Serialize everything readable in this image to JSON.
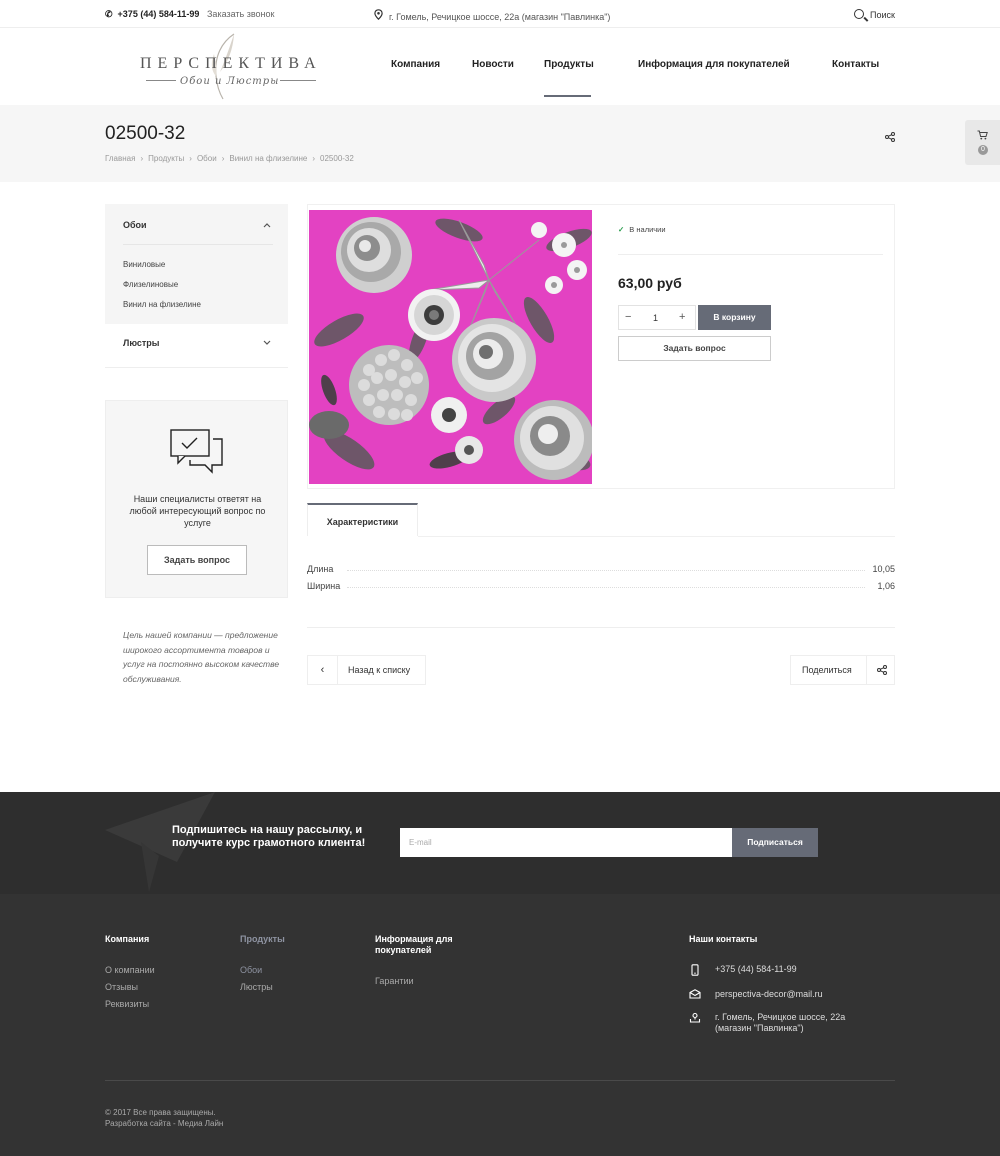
{
  "topbar": {
    "phone": "+375 (44) 584-11-99",
    "callback": "Заказать звонок",
    "address": "г. Гомель, Речицкое шоссе, 22а (магазин \"Павлинка\")",
    "search": "Поиск"
  },
  "logo": {
    "main": "ПЕРСПЕКТИВА",
    "sub": "Обои и Люстры"
  },
  "nav": [
    {
      "label": "Компания"
    },
    {
      "label": "Новости"
    },
    {
      "label": "Продукты",
      "active": true
    },
    {
      "label": "Информация для покупателей"
    },
    {
      "label": "Контакты"
    }
  ],
  "page": {
    "title": "02500-32",
    "breadcrumb": [
      "Главная",
      "Продукты",
      "Обои",
      "Винил на флизелине",
      "02500-32"
    ]
  },
  "cart": {
    "count": "0"
  },
  "sidebar": {
    "category": "Обои",
    "subcategories": [
      "Виниловые",
      "Флизелиновые",
      "Винил на флизелине"
    ],
    "category2": "Люстры",
    "ask_text": "Наши специалисты ответят на любой интересующий вопрос по услуге",
    "ask_button": "Задать вопрос",
    "mission": "Цель нашей компании — предложение широкого ассортимента товаров и услуг на постоянно высоком качестве обслуживания."
  },
  "product": {
    "stock": "В наличии",
    "price": "63,00 руб",
    "qty": "1",
    "minus": "−",
    "plus": "+",
    "to_cart": "В корзину",
    "ask": "Задать вопрос",
    "tab": "Характеристики",
    "props": [
      {
        "key": "Длина",
        "value": "10,05"
      },
      {
        "key": "Ширина",
        "value": "1,06"
      }
    ],
    "back": "Назад к списку",
    "share": "Поделиться"
  },
  "subscribe": {
    "text": "Подпишитесь на нашу рассылку, и получите курс грамотного клиента!",
    "placeholder": "E-mail",
    "button": "Подписаться"
  },
  "footer": {
    "col1": {
      "title": "Компания",
      "links": [
        "О компании",
        "Отзывы",
        "Реквизиты"
      ]
    },
    "col2": {
      "title": "Продукты",
      "links": [
        "Обои",
        "Люстры"
      ]
    },
    "col3": {
      "title": "Информация для покупателей",
      "links": [
        "Гарантии"
      ]
    },
    "contacts": {
      "title": "Наши контакты",
      "phone": "+375 (44) 584-11-99",
      "email": "perspectiva-decor@mail.ru",
      "address": "г. Гомель, Речицкое шоссе, 22а (магазин \"Павлинка\")"
    },
    "copyright": "© 2017 Все права защищены.",
    "developer": "Разработка сайта - Медиа Лайн"
  },
  "colors": {
    "accent": "#666b77",
    "footer": "#333333",
    "subscribe": "#2e2e2e",
    "stock_check": "#2a9d4e",
    "wallpaper_bg": "#e342c2"
  }
}
